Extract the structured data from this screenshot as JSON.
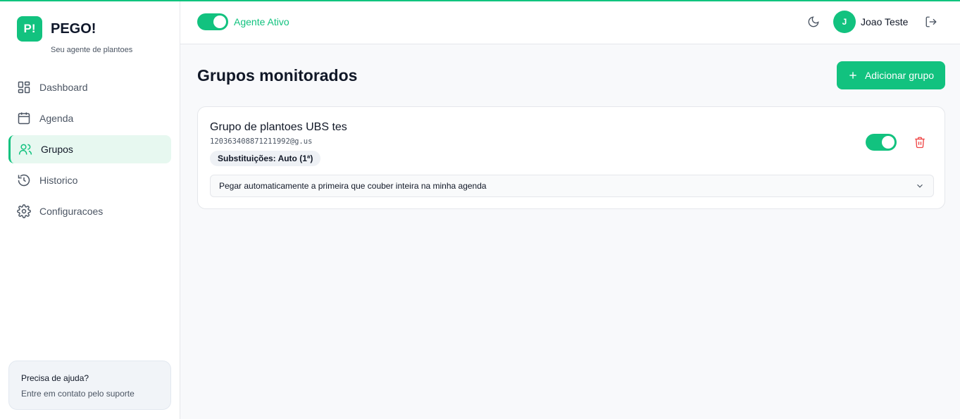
{
  "brand": {
    "logo_text": "P!",
    "name": "PEGO!",
    "subtitle": "Seu agente de plantoes"
  },
  "sidebar": {
    "items": [
      {
        "label": "Dashboard",
        "icon": "dashboard-icon",
        "active": false
      },
      {
        "label": "Agenda",
        "icon": "calendar-icon",
        "active": false
      },
      {
        "label": "Grupos",
        "icon": "users-icon",
        "active": true
      },
      {
        "label": "Historico",
        "icon": "history-icon",
        "active": false
      },
      {
        "label": "Configuracoes",
        "icon": "gear-icon",
        "active": false
      }
    ],
    "help": {
      "title": "Precisa de ajuda?",
      "text": "Entre em contato pelo suporte"
    }
  },
  "header": {
    "agent_label": "Agente Ativo",
    "agent_on": true,
    "user_initial": "J",
    "user_name": "Joao Teste"
  },
  "main": {
    "title": "Grupos monitorados",
    "add_button": "Adicionar grupo",
    "groups": [
      {
        "name": "Grupo de plantoes UBS tes",
        "id": "120363408871211992@g.us",
        "badge": "Substituições: Auto (1ª)",
        "enabled": true,
        "mode": "Pegar automaticamente a primeira que couber inteira na minha agenda"
      }
    ]
  },
  "colors": {
    "accent": "#12c27f",
    "danger": "#ef4444",
    "active_bg": "#e7f8f0"
  }
}
